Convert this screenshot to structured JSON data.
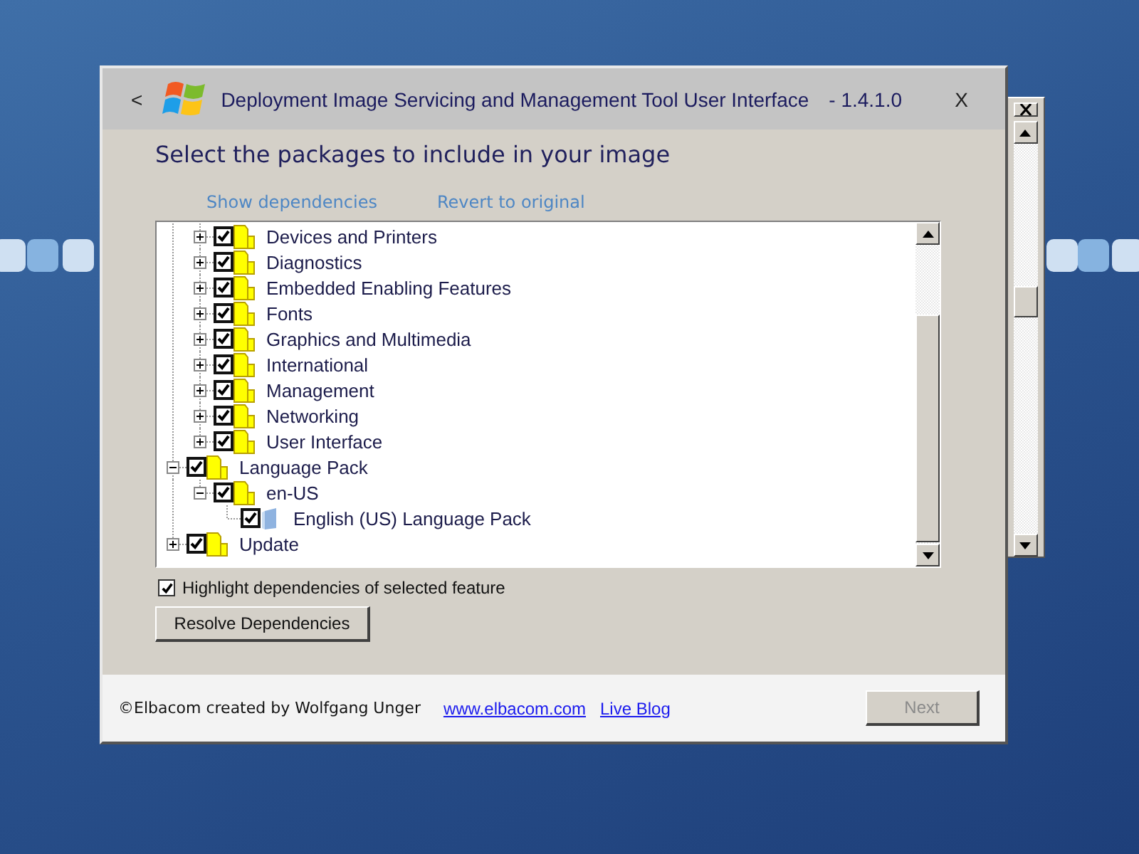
{
  "window": {
    "back_button": "<",
    "title": "Deployment Image Servicing and Management Tool User Interface",
    "version": "- 1.4.1.0",
    "close_button": "X"
  },
  "heading": "Select the packages to include in your image",
  "links": [
    "Show dependencies",
    "Revert to original"
  ],
  "tree": {
    "items": [
      {
        "children": [
          {
            "label": "Devices and Printers",
            "checked": true,
            "expanded": false,
            "kind": "folder"
          },
          {
            "label": "Diagnostics",
            "checked": true,
            "expanded": false,
            "kind": "folder"
          },
          {
            "label": "Embedded Enabling Features",
            "checked": true,
            "expanded": false,
            "kind": "folder"
          },
          {
            "label": "Fonts",
            "checked": true,
            "expanded": false,
            "kind": "folder"
          },
          {
            "label": "Graphics and Multimedia",
            "checked": true,
            "expanded": false,
            "kind": "folder"
          },
          {
            "label": "International",
            "checked": true,
            "expanded": false,
            "kind": "folder"
          },
          {
            "label": "Management",
            "checked": true,
            "expanded": false,
            "kind": "folder"
          },
          {
            "label": "Networking",
            "checked": true,
            "expanded": false,
            "kind": "folder"
          },
          {
            "label": "User Interface",
            "checked": true,
            "expanded": false,
            "kind": "folder"
          }
        ]
      },
      {
        "label": "Language Pack",
        "checked": true,
        "expanded": true,
        "kind": "folder",
        "children": [
          {
            "label": "en-US",
            "checked": true,
            "expanded": true,
            "kind": "folder",
            "children": [
              {
                "label": "English (US) Language Pack",
                "checked": true,
                "kind": "package"
              }
            ]
          }
        ]
      },
      {
        "label": "Update",
        "checked": true,
        "expanded": false,
        "kind": "folder"
      }
    ]
  },
  "highlight_option": {
    "label": "Highlight dependencies of selected feature",
    "checked": true
  },
  "resolve_button": "Resolve Dependencies",
  "footer": {
    "credit": "©Elbacom created by Wolfgang Unger",
    "links": [
      "www.elbacom.com",
      "Live Blog"
    ],
    "next_button": {
      "label": "Next",
      "disabled": true
    }
  }
}
